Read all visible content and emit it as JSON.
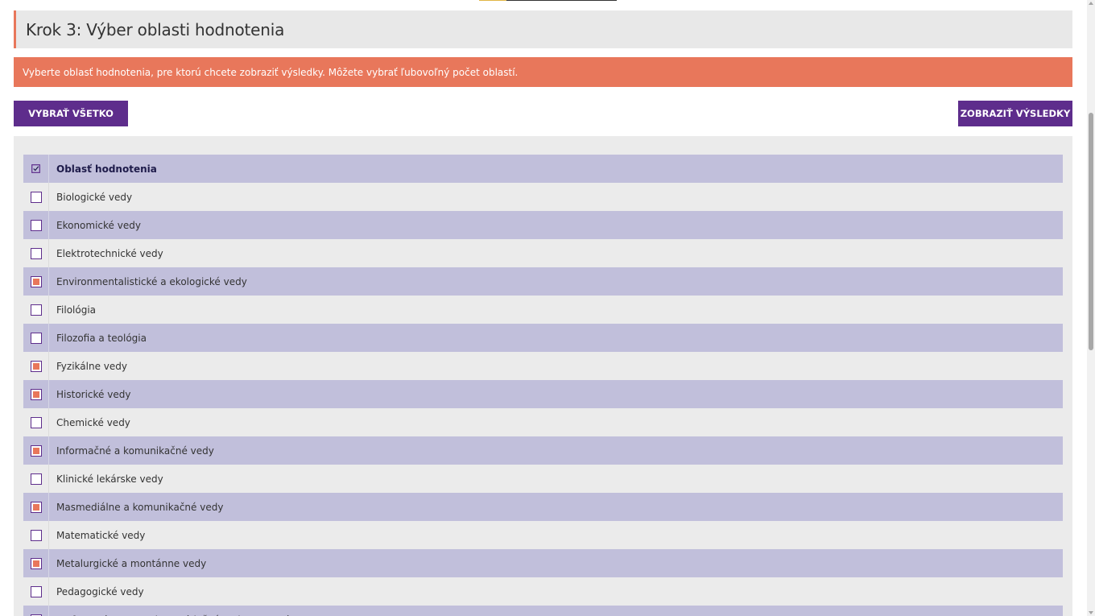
{
  "header": {
    "title": "Krok 3: Výber oblasti hodnotenia"
  },
  "alert": {
    "text": "Vyberte oblasť hodnotenia, pre ktorú chcete zobraziť výsledky. Môžete vybrať ľubovoľný počet oblastí."
  },
  "actions": {
    "select_all_label": "VYBRAŤ VŠETKO",
    "show_results_label": "ZOBRAZIŤ VÝSLEDKY"
  },
  "colors": {
    "accent": "#e8775b",
    "primary": "#5e2d8c",
    "row_shade": "#c1bfdb",
    "panel": "#ebebeb"
  },
  "table": {
    "header_label": "Oblasť hodnotenia",
    "header_icon": "check-square-icon",
    "rows": [
      {
        "label": "Biologické vedy",
        "checked": false
      },
      {
        "label": "Ekonomické vedy",
        "checked": false
      },
      {
        "label": "Elektrotechnické vedy",
        "checked": false
      },
      {
        "label": "Environmentalistické a ekologické vedy",
        "checked": true
      },
      {
        "label": "Filológia",
        "checked": false
      },
      {
        "label": "Filozofia a teológia",
        "checked": false
      },
      {
        "label": "Fyzikálne vedy",
        "checked": true
      },
      {
        "label": "Historické vedy",
        "checked": true
      },
      {
        "label": "Chemické vedy",
        "checked": false
      },
      {
        "label": "Informačné a komunikačné vedy",
        "checked": true
      },
      {
        "label": "Klinické lekárske vedy",
        "checked": false
      },
      {
        "label": "Masmediálne a komunikačné vedy",
        "checked": true
      },
      {
        "label": "Matematické vedy",
        "checked": false
      },
      {
        "label": "Metalurgické a montánne vedy",
        "checked": true
      },
      {
        "label": "Pedagogické vedy",
        "checked": false
      },
      {
        "label": "Performatívne umenie a príslušné vedy o umení",
        "checked": false
      }
    ]
  }
}
